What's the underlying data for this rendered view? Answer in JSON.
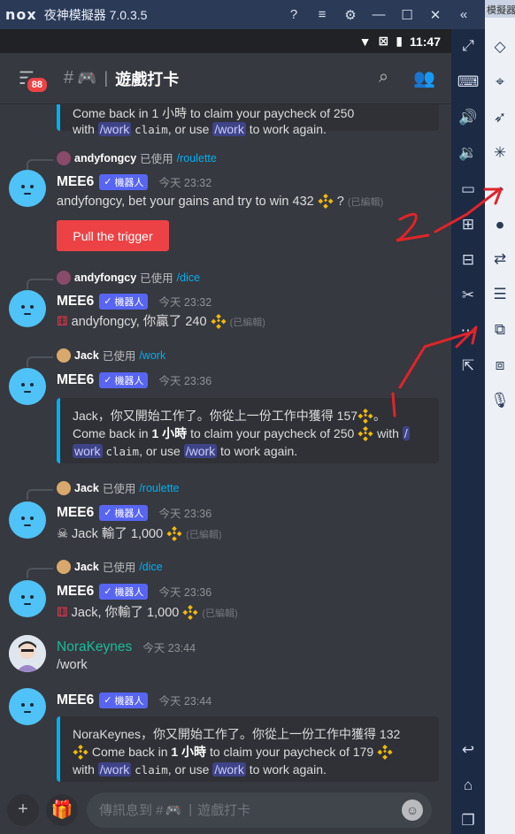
{
  "nox": {
    "logo": "nox",
    "title": "夜神模擬器 7.0.3.5",
    "extra_label": "模擬器",
    "controls": [
      "?",
      "≡",
      "⚙",
      "—",
      "☐",
      "✕",
      "«"
    ],
    "left_tools": [
      "fullscreen-icon",
      "keyboard-icon",
      "volume-up-icon",
      "volume-down-icon",
      "screenshot-icon",
      "apk-icon",
      "virtual-keys-icon",
      "scissors-icon",
      "more-icon",
      "external-icon",
      "back-icon",
      "home-icon",
      "recents-icon"
    ],
    "right_tools": [
      "diamond-icon",
      "location-icon",
      "rocket-icon",
      "loading-icon",
      "record-icon",
      "sync-icon",
      "menu-icon",
      "rec-icon",
      "multi-window-icon",
      "mic-icon"
    ]
  },
  "status_bar": {
    "time": "11:47"
  },
  "header": {
    "badge": "88",
    "hash": "#",
    "emoji": "🎮",
    "separator": "|",
    "channel_name": "遊戲打卡"
  },
  "messages": {
    "top_embed": {
      "line1": "Come back in 1 小時 to claim your paycheck of 250",
      "with_text": "with",
      "cmd_work": "/work",
      "claim": "claim",
      "or_use": ", or use",
      "to_work": "to work again."
    },
    "m1": {
      "reply_user": "andyfongcy",
      "reply_used": "已使用",
      "reply_cmd": "/roulette",
      "author": "MEE6",
      "bot": "機器人",
      "time": "今天 23:32",
      "text": "andyfongcy, bet your gains and try to win 432",
      "text_tail": "?",
      "edited": "(已編輯)",
      "button": "Pull the trigger"
    },
    "m2": {
      "reply_user": "andyfongcy",
      "reply_used": "已使用",
      "reply_cmd": "/dice",
      "author": "MEE6",
      "bot": "機器人",
      "time": "今天 23:32",
      "text": "andyfongcy, 你贏了 240",
      "edited": "(已編輯)"
    },
    "m3": {
      "reply_user": "Jack",
      "reply_used": "已使用",
      "reply_cmd": "/work",
      "author": "MEE6",
      "bot": "機器人",
      "time": "今天 23:36",
      "embed_l1": "Jack，你又開始工作了。你從上一份工作中獲得 157",
      "embed_l1_tail": "。",
      "embed_l2a": "Come back in",
      "embed_l2b": "1 小時",
      "embed_l2c": "to claim your paycheck of 250",
      "embed_l2d": "with",
      "cmd_slash": "/",
      "cmd_work": "work",
      "claim": "claim",
      "or_use": ", or use",
      "cmd_work2": "/work",
      "to_work": "to work again."
    },
    "m4": {
      "reply_user": "Jack",
      "reply_used": "已使用",
      "reply_cmd": "/roulette",
      "author": "MEE6",
      "bot": "機器人",
      "time": "今天 23:36",
      "text": "Jack 輸了 1,000",
      "edited": "(已編輯)"
    },
    "m5": {
      "reply_user": "Jack",
      "reply_used": "已使用",
      "reply_cmd": "/dice",
      "author": "MEE6",
      "bot": "機器人",
      "time": "今天 23:36",
      "text": "Jack, 你輸了 1,000",
      "edited": "(已編輯)"
    },
    "m6": {
      "author": "NoraKeynes",
      "time": "今天 23:44",
      "text": "/work"
    },
    "m7": {
      "author": "MEE6",
      "bot": "機器人",
      "time": "今天 23:44",
      "embed_l1": "NoraKeynes，你又開始工作了。你從上一份工作中獲得 132",
      "embed_l2a": "Come back in",
      "embed_l2b": "1 小時",
      "embed_l2c": "to claim your paycheck of 179",
      "with_text": "with",
      "cmd_work": "/work",
      "claim": "claim",
      "or_use": ", or use",
      "cmd_work2": "/work",
      "to_work": "to work again."
    }
  },
  "input": {
    "placeholder_a": "傳訊息到 #",
    "placeholder_emoji": "🎮",
    "placeholder_sep": "|",
    "placeholder_b": "遊戲打卡"
  },
  "annotations": {
    "label_1": "1",
    "label_2": "2",
    "color": "#e0242a"
  }
}
